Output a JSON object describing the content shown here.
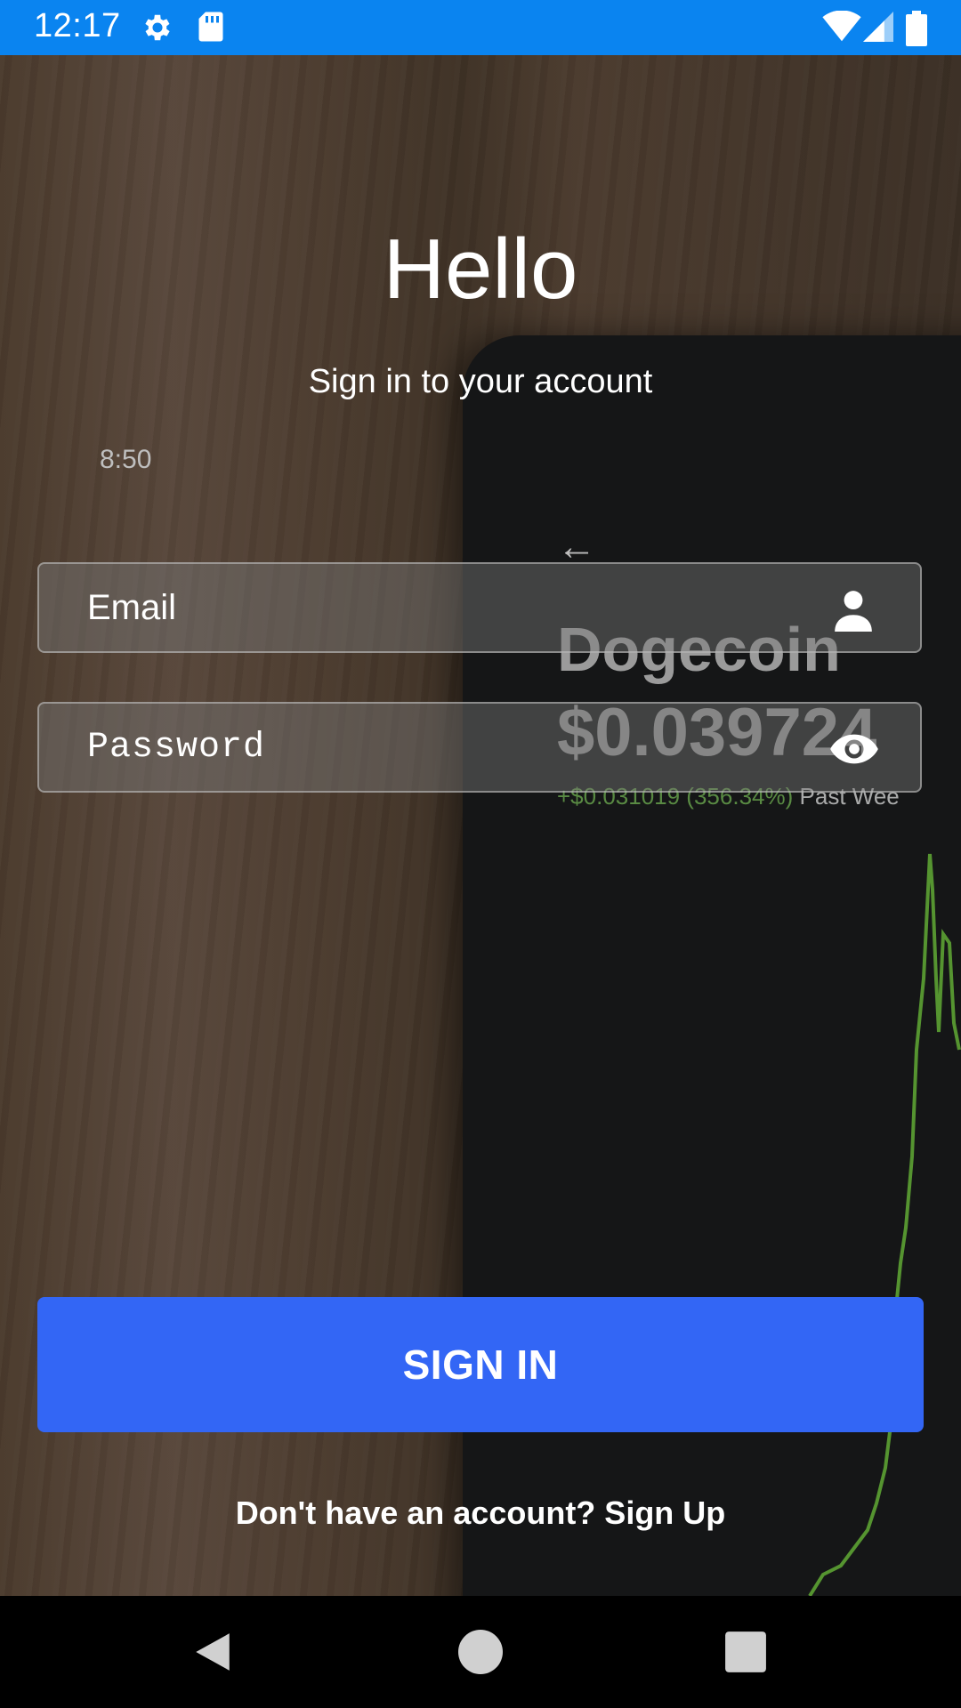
{
  "status_bar": {
    "time": "12:17"
  },
  "background_phone": {
    "status": "8:50",
    "coin_name": "Dogecoin",
    "price": "$0.039724",
    "change": "+$0.031019 (356.34%)",
    "period": "Past Wee"
  },
  "login": {
    "title": "Hello",
    "subtitle": "Sign in to your account",
    "email_placeholder": "Email",
    "password_placeholder": "Password",
    "sign_in_label": "SIGN IN",
    "sign_up_prompt": "Don't have an account? Sign Up"
  },
  "icons": {
    "status": [
      "gear-icon",
      "sd-card-icon",
      "wifi-icon",
      "signal-icon",
      "battery-icon"
    ],
    "email": "person-icon",
    "password": "eye-icon",
    "nav": [
      "back-icon",
      "home-icon",
      "recents-icon"
    ]
  },
  "colors": {
    "status_bar": "#0a84f0",
    "button": "#3366f5"
  }
}
